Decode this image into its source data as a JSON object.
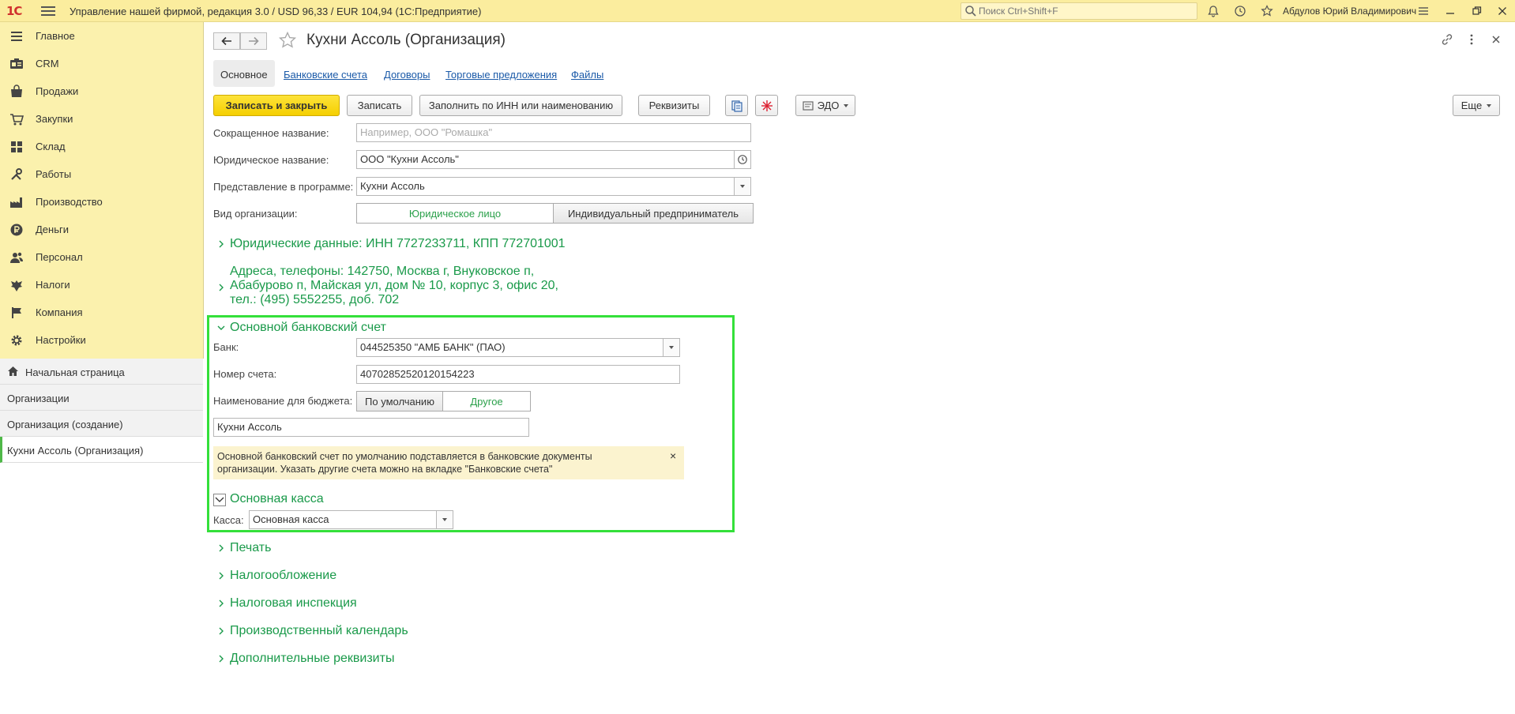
{
  "app": {
    "logo": "1С",
    "title": "Управление нашей фирмой, редакция 3.0 / USD 96,33 / EUR 104,94  (1С:Предприятие)",
    "search_placeholder": "Поиск Ctrl+Shift+F",
    "user": "Абдулов Юрий Владимирович"
  },
  "sidebar": {
    "items": [
      {
        "label": "Главное",
        "icon": "menu-lines-icon"
      },
      {
        "label": "CRM",
        "icon": "crm-icon"
      },
      {
        "label": "Продажи",
        "icon": "sales-bag-icon"
      },
      {
        "label": "Закупки",
        "icon": "purchases-icon"
      },
      {
        "label": "Склад",
        "icon": "warehouse-grid-icon"
      },
      {
        "label": "Работы",
        "icon": "tools-icon"
      },
      {
        "label": "Производство",
        "icon": "factory-icon"
      },
      {
        "label": "Деньги",
        "icon": "ruble-coin-icon"
      },
      {
        "label": "Персонал",
        "icon": "people-icon"
      },
      {
        "label": "Налоги",
        "icon": "eagle-icon"
      },
      {
        "label": "Компания",
        "icon": "flag-icon"
      },
      {
        "label": "Настройки",
        "icon": "gear-icon"
      }
    ],
    "open_windows": [
      {
        "label": "Начальная страница",
        "icon": "home-icon"
      },
      {
        "label": "Организации"
      },
      {
        "label": "Организация (создание)"
      },
      {
        "label": "Кухни Ассоль (Организация)"
      }
    ]
  },
  "form": {
    "title": "Кухни Ассоль (Организация)",
    "tabs": [
      "Основное",
      "Банковские счета",
      "Договоры",
      "Торговые предложения",
      "Файлы"
    ],
    "buttons": {
      "save_close": "Записать и закрыть",
      "save": "Записать",
      "fill_inn": "Заполнить по ИНН или наименованию",
      "details": "Реквизиты",
      "edo": "ЭДО",
      "more": "Еще"
    },
    "fields": {
      "short_name_label": "Сокращенное название:",
      "short_name_placeholder": "Например, ООО \"Ромашка\"",
      "legal_name_label": "Юридическое название:",
      "legal_name_value": "ООО \"Кухни Ассоль\"",
      "display_label": "Представление в программе:",
      "display_value": "Кухни Ассоль",
      "org_type_label": "Вид организации:",
      "org_type_options": [
        "Юридическое лицо",
        "Индивидуальный предприниматель"
      ]
    },
    "groups": {
      "legal_data": "Юридические данные: ИНН 7727233711, КПП 772701001",
      "addresses": "Адреса, телефоны: 142750, Москва г, Внуковское п, Абабурово п, Майская ул, дом № 10, корпус 3, офис 20, тел.: (495) 5552255, доб. 702",
      "main_bank_account": "Основной банковский счет",
      "main_cash": "Основная касса",
      "print": "Печать",
      "taxation": "Налогообложение",
      "tax_inspection": "Налоговая инспекция",
      "calendar": "Производственный календарь",
      "additional": "Дополнительные реквизиты"
    },
    "bank": {
      "bank_label": "Банк:",
      "bank_value": "044525350 \"АМБ БАНК\" (ПАО)",
      "account_label": "Номер счета:",
      "account_value": "40702852520120154223",
      "budget_label": "Наименование для бюджета:",
      "budget_options": [
        "По умолчанию",
        "Другое"
      ],
      "budget_name": "Кухни Ассоль",
      "info": "Основной банковский счет по умолчанию подставляется в банковские документы организации. Указать другие счета можно на вкладке \"Банковские счета\"",
      "close_symbol": "×"
    },
    "cash": {
      "label": "Касса:",
      "value": "Основная касса"
    }
  },
  "colors": {
    "topbar": "#fbed9e",
    "sidebar": "#fbf1ad",
    "group_green": "#1a9a4a",
    "link_blue": "#1b5aa8",
    "highlight": "#34e03a"
  }
}
